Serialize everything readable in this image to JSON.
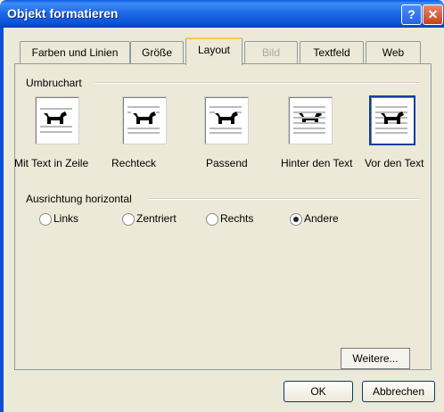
{
  "window": {
    "title": "Objekt formatieren"
  },
  "tabs": [
    {
      "label": "Farben und Linien"
    },
    {
      "label": "Größe"
    },
    {
      "label": "Layout"
    },
    {
      "label": "Bild"
    },
    {
      "label": "Textfeld"
    },
    {
      "label": "Web"
    }
  ],
  "umbruchart": {
    "heading": "Umbruchart",
    "options": [
      {
        "label": "Mit Text in Zeile",
        "icon": "inline-with-text-icon"
      },
      {
        "label": "Rechteck",
        "icon": "square-wrap-icon"
      },
      {
        "label": "Passend",
        "icon": "tight-wrap-icon"
      },
      {
        "label": "Hinter den Text",
        "icon": "behind-text-icon"
      },
      {
        "label": "Vor den Text",
        "icon": "in-front-of-text-icon",
        "selected": true
      }
    ]
  },
  "ausrichtung": {
    "heading": "Ausrichtung horizontal",
    "options": [
      {
        "label": "Links"
      },
      {
        "label": "Zentriert"
      },
      {
        "label": "Rechts"
      },
      {
        "label": "Andere",
        "selected": true
      }
    ]
  },
  "buttons": {
    "weitere": "Weitere...",
    "ok": "OK",
    "cancel": "Abbrechen"
  },
  "colors": {
    "titlebar": "#0a52d6",
    "dialog": "#ece9d8",
    "active_tab_accent": "#fbc54d"
  }
}
